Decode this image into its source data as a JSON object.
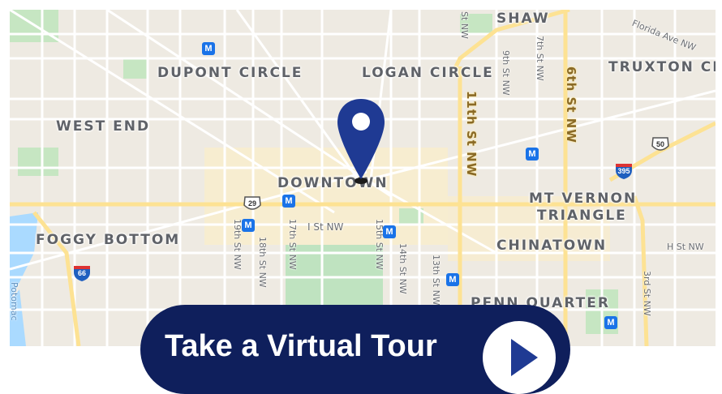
{
  "map": {
    "neighborhoods": {
      "shaw": "SHAW",
      "dupont_circle": "DUPONT CIRCLE",
      "logan_circle": "LOGAN CIRCLE",
      "truxton_circle": "TRUXTON CI",
      "west_end": "WEST END",
      "downtown": "DOWNTOWN",
      "mt_vernon_triangle_1": "MT VERNON",
      "mt_vernon_triangle_2": "TRIANGLE",
      "foggy_bottom": "FOGGY BOTTOM",
      "chinatown": "CHINATOWN",
      "penn_quarter": "PENN QUARTER"
    },
    "streets": {
      "florida_ave": "Florida Ave NW",
      "st_nw_top": "St NW",
      "ninth_st": "9th St NW",
      "seventh_st": "7th St NW",
      "sixth_st": "6th St NW",
      "eleventh_st": "11th St NW",
      "i_st": "I St NW",
      "h_st": "H St NW",
      "nineteenth_st": "19th St NW",
      "eighteenth_st": "18th St NW",
      "seventeenth_st": "17th St NW",
      "fifteenth_st": "15th St NW",
      "fourteenth_st": "14th St NW",
      "thirteenth_st": "13th St NW",
      "third_st": "3rd St NW",
      "potomac": "Potomac"
    },
    "shields": {
      "us29": "29",
      "us50": "50",
      "i395": "395",
      "i66": "66"
    },
    "metro_symbol": "M",
    "colors": {
      "background": "#eeeae2",
      "major_road": "#fde293",
      "park": "#bfe3c0",
      "water": "#aadaff",
      "metro": "#1a73e8",
      "pin": "#1f3a93"
    }
  },
  "cta": {
    "label": "Take a Virtual Tour",
    "background": "#0f1f5c"
  }
}
